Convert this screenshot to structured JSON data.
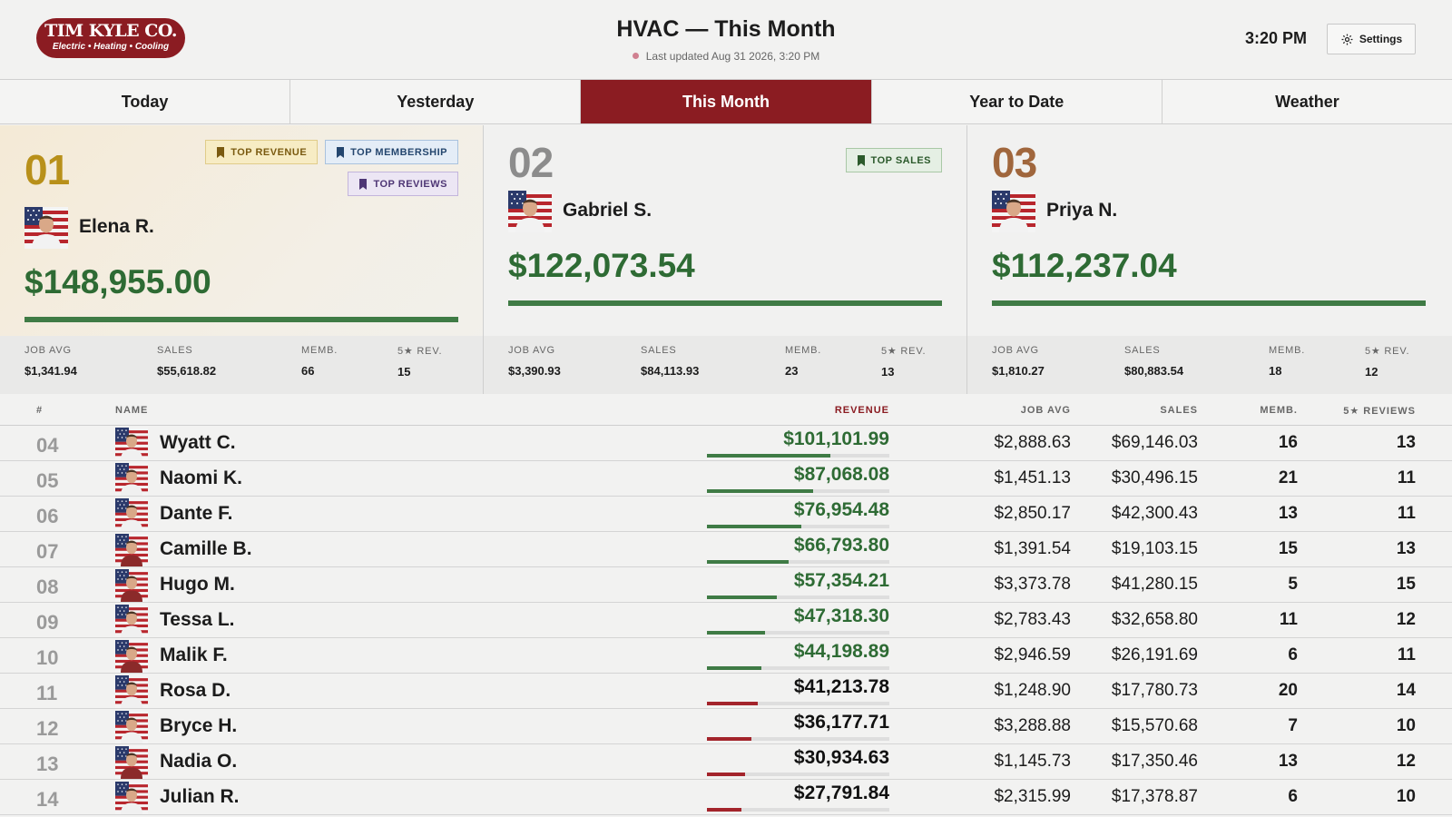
{
  "header": {
    "logo_line1": "TIM KYLE CO.",
    "logo_line2": "Electric • Heating • Cooling",
    "title": "HVAC — This Month",
    "last_updated": "Last updated Aug 31 2026, 3:20 PM",
    "clock": "3:20 PM",
    "settings_label": "Settings"
  },
  "tabs": [
    {
      "label": "Today",
      "active": false
    },
    {
      "label": "Yesterday",
      "active": false
    },
    {
      "label": "This Month",
      "active": true
    },
    {
      "label": "Year to Date",
      "active": false
    },
    {
      "label": "Weather",
      "active": false
    }
  ],
  "colors": {
    "brand": "#8b1c22",
    "money_green": "#2e6b34",
    "bar_green": "#3f7b45",
    "bar_red": "#a3242b",
    "gold_rank": "#b8901a",
    "silver_rank": "#8c8c8c",
    "bronze_rank": "#a0663c"
  },
  "podium": [
    {
      "rank": "01",
      "name": "Elena R.",
      "revenue": "$148,955.00",
      "badges": [
        {
          "label": "TOP REVENUE",
          "kind": "rev"
        },
        {
          "label": "TOP MEMBERSHIP",
          "kind": "mem"
        },
        {
          "label": "TOP REVIEWS",
          "kind": "rvw"
        }
      ],
      "stat_labels": [
        "JOB AVG",
        "SALES",
        "MEMB.",
        "5★ REV."
      ],
      "stat_values": [
        "$1,341.94",
        "$55,618.82",
        "66",
        "15"
      ]
    },
    {
      "rank": "02",
      "name": "Gabriel S.",
      "revenue": "$122,073.54",
      "badges": [
        {
          "label": "TOP SALES",
          "kind": "sales"
        }
      ],
      "stat_labels": [
        "JOB AVG",
        "SALES",
        "MEMB.",
        "5★ REV."
      ],
      "stat_values": [
        "$3,390.93",
        "$84,113.93",
        "23",
        "13"
      ]
    },
    {
      "rank": "03",
      "name": "Priya N.",
      "revenue": "$112,237.04",
      "badges": [],
      "stat_labels": [
        "JOB AVG",
        "SALES",
        "MEMB.",
        "5★ REV."
      ],
      "stat_values": [
        "$1,810.27",
        "$80,883.54",
        "18",
        "12"
      ]
    }
  ],
  "table": {
    "headers": {
      "rank": "#",
      "name": "NAME",
      "revenue": "REVENUE",
      "job_avg": "JOB AVG",
      "sales": "SALES",
      "memb": "MEMB.",
      "reviews": "5★ REVIEWS"
    },
    "rows": [
      {
        "rank": "04",
        "name": "Wyatt C.",
        "revenue": "$101,101.99",
        "revenue_value": 101101.99,
        "job_avg": "$2,888.63",
        "sales": "$69,146.03",
        "memb": "16",
        "reviews": "13"
      },
      {
        "rank": "05",
        "name": "Naomi K.",
        "revenue": "$87,068.08",
        "revenue_value": 87068.08,
        "job_avg": "$1,451.13",
        "sales": "$30,496.15",
        "memb": "21",
        "reviews": "11"
      },
      {
        "rank": "06",
        "name": "Dante F.",
        "revenue": "$76,954.48",
        "revenue_value": 76954.48,
        "job_avg": "$2,850.17",
        "sales": "$42,300.43",
        "memb": "13",
        "reviews": "11"
      },
      {
        "rank": "07",
        "name": "Camille B.",
        "revenue": "$66,793.80",
        "revenue_value": 66793.8,
        "job_avg": "$1,391.54",
        "sales": "$19,103.15",
        "memb": "15",
        "reviews": "13"
      },
      {
        "rank": "08",
        "name": "Hugo M.",
        "revenue": "$57,354.21",
        "revenue_value": 57354.21,
        "job_avg": "$3,373.78",
        "sales": "$41,280.15",
        "memb": "5",
        "reviews": "15"
      },
      {
        "rank": "09",
        "name": "Tessa L.",
        "revenue": "$47,318.30",
        "revenue_value": 47318.3,
        "job_avg": "$2,783.43",
        "sales": "$32,658.80",
        "memb": "11",
        "reviews": "12"
      },
      {
        "rank": "10",
        "name": "Malik F.",
        "revenue": "$44,198.89",
        "revenue_value": 44198.89,
        "job_avg": "$2,946.59",
        "sales": "$26,191.69",
        "memb": "6",
        "reviews": "11"
      },
      {
        "rank": "11",
        "name": "Rosa D.",
        "revenue": "$41,213.78",
        "revenue_value": 41213.78,
        "job_avg": "$1,248.90",
        "sales": "$17,780.73",
        "memb": "20",
        "reviews": "14"
      },
      {
        "rank": "12",
        "name": "Bryce H.",
        "revenue": "$36,177.71",
        "revenue_value": 36177.71,
        "job_avg": "$3,288.88",
        "sales": "$15,570.68",
        "memb": "7",
        "reviews": "10"
      },
      {
        "rank": "13",
        "name": "Nadia O.",
        "revenue": "$30,934.63",
        "revenue_value": 30934.63,
        "job_avg": "$1,145.73",
        "sales": "$17,350.46",
        "memb": "13",
        "reviews": "12"
      },
      {
        "rank": "14",
        "name": "Julian R.",
        "revenue": "$27,791.84",
        "revenue_value": 27791.84,
        "job_avg": "$2,315.99",
        "sales": "$17,378.87",
        "memb": "6",
        "reviews": "10"
      }
    ]
  }
}
